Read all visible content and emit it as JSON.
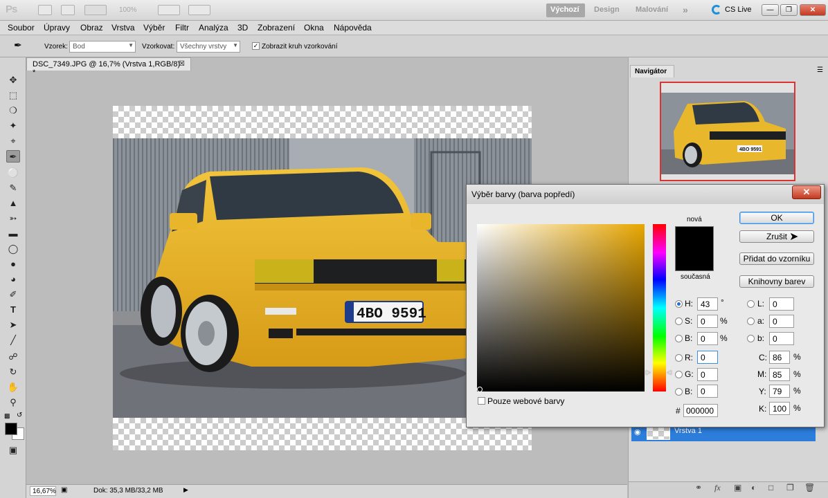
{
  "app": {
    "logo": "Ps",
    "zoom_level": "100%",
    "workspaces": [
      "Výchozí",
      "Design",
      "Malování"
    ],
    "more_workspaces": "»",
    "cs_live": "CS Live"
  },
  "menu": [
    "Soubor",
    "Úpravy",
    "Obraz",
    "Vrstva",
    "Výběr",
    "Filtr",
    "Analýza",
    "3D",
    "Zobrazení",
    "Okna",
    "Nápověda"
  ],
  "options": {
    "sample_label": "Vzorek:",
    "sample_value": "Bod",
    "layers_label": "Vzorkovat:",
    "layers_value": "Všechny vrstvy",
    "ring_label": "Zobrazit kruh vzorkování",
    "ring_checked": true
  },
  "document": {
    "tab_title": "DSC_7349.JPG @ 16,7% (Vrstva 1,RGB/8) *",
    "plate": "4BO 9591",
    "zoom": "16,67%",
    "info": "Dok: 35,3 MB/33,2 MB"
  },
  "navigator": {
    "tab": "Navigátor",
    "plate": "4BO 9591"
  },
  "layers": {
    "layer_name": "Vrstva 1"
  },
  "dialog": {
    "title": "Výběr barvy (barva popředí)",
    "new_label": "nová",
    "current_label": "současná",
    "ok": "OK",
    "cancel": "Zrušit",
    "add_swatch": "Přidat do vzorníku",
    "libraries": "Knihovny barev",
    "web_only": "Pouze webové barvy",
    "selected_color": "#000000",
    "fields": {
      "H": {
        "label": "H:",
        "value": "43",
        "unit": "°"
      },
      "S": {
        "label": "S:",
        "value": "0",
        "unit": "%"
      },
      "B": {
        "label": "B:",
        "value": "0",
        "unit": "%"
      },
      "R": {
        "label": "R:",
        "value": "0"
      },
      "G": {
        "label": "G:",
        "value": "0"
      },
      "Bb": {
        "label": "B:",
        "value": "0"
      },
      "L": {
        "label": "L:",
        "value": "0"
      },
      "a": {
        "label": "a:",
        "value": "0"
      },
      "b": {
        "label": "b:",
        "value": "0"
      },
      "C": {
        "label": "C:",
        "value": "86",
        "unit": "%"
      },
      "M": {
        "label": "M:",
        "value": "85",
        "unit": "%"
      },
      "Y": {
        "label": "Y:",
        "value": "79",
        "unit": "%"
      },
      "K": {
        "label": "K:",
        "value": "100",
        "unit": "%"
      }
    },
    "hex_label": "#",
    "hex_value": "000000"
  }
}
